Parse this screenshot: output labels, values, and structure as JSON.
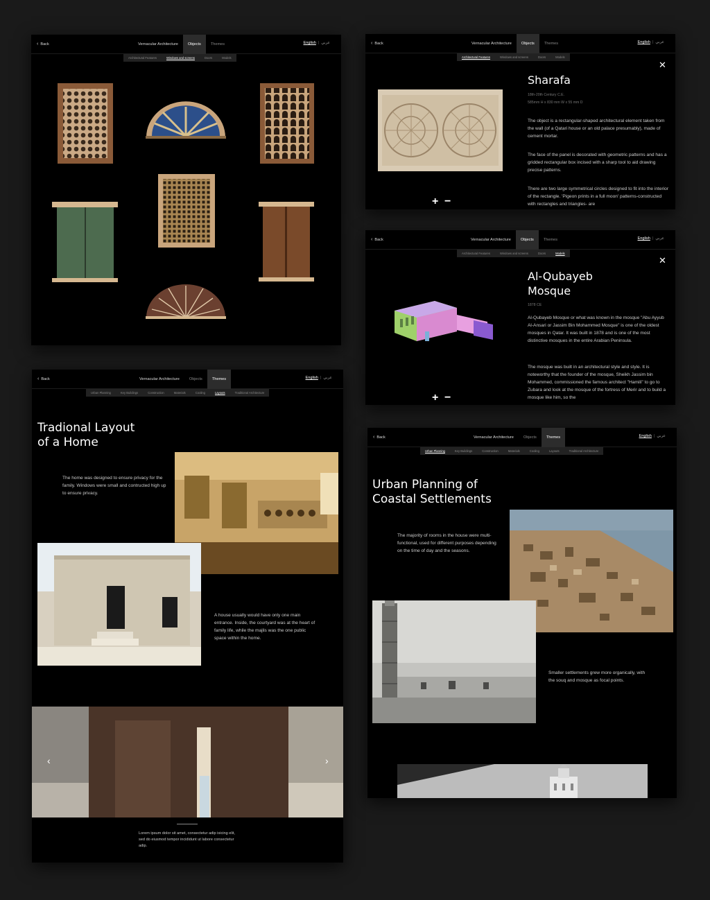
{
  "nav": {
    "back": "Back",
    "title": "Vernacular Architecture",
    "objects": "Objects",
    "themes": "Themes",
    "lang_en": "English",
    "lang_ar": "عربي"
  },
  "object_subnav": [
    "Architectural Features",
    "Windows and screens",
    "Doors",
    "Models"
  ],
  "theme_subnav": [
    "Urban Planning",
    "Key Buildings",
    "Construction",
    "Materials",
    "Cooling",
    "Layouts",
    "Traditional Architecture"
  ],
  "panel_gallery": {
    "active_tab": "Objects",
    "active_sub": "Windows and screens"
  },
  "panel_sharafa": {
    "active_tab": "Objects",
    "active_sub": "Architectural Features",
    "title": "Sharafa",
    "date": "18th-20th Century C.E.",
    "dimensions": "585mm H x 830 mm W x 55 mm D",
    "p1": "The object is a rectangular-shaped architectural element taken from the wall (of a Qatari house or an old palace presumably), made of cement mortar.",
    "p2": "The face of the panel is decorated with geometric patterns and has a gridded rectangular box incised with a sharp tool to aid drawing precise patterns.",
    "p3": "There are two large symmetrical circles designed to fit into the interior of the rectangle. 'Pigeon prints in a full moon' patterns-constructed with rectangles and triangles- are",
    "close": "✕",
    "zoom_in": "+",
    "zoom_out": "−"
  },
  "panel_mosque": {
    "active_tab": "Objects",
    "active_sub": "Models",
    "title_line1": "Al-Qubayeb",
    "title_line2": "Mosque",
    "date": "1878 CE",
    "p1": "Al-Qubayeb Mosque or what was known in the mosque \"Abu Ayyub Al-Ansari or Jassim Bin Mohammed Mosque\" is one of the oldest mosques in Qatar. It was built in 1878 and is one of the most distinctive mosques in the entire Arabian Peninsula.",
    "p2": "The mosque was built in an architectural style and style. It is noteworthy that the founder of the mosque, Sheikh Jassim bin Mohammed, commissioned the famous architect \"Hamili\" to go to Zubara and look at the mosque of the fortress of Merir and to build a mosque like him, so the",
    "close": "✕",
    "zoom_in": "+",
    "zoom_out": "−"
  },
  "panel_layout": {
    "active_tab": "Themes",
    "active_sub": "Layouts",
    "title_line1": "Tradional Layout",
    "title_line2": "of a Home",
    "p1": "The home was designed to ensure privacy for the family. Windows were small and contructed high up to ensure privacy.",
    "p2": "A house usually would have only one main entrance. Inside, the courtyard was at the heart of family life, while the majlis was the one public space within the home.",
    "caption": "Lorem ipsum dolor sit amet, consectetur adip isicing elit, sed do eiusmod tempor incididunt ut labore consectetur adip.",
    "prev": "‹",
    "next": "›"
  },
  "panel_urban": {
    "active_tab": "Themes",
    "active_sub": "Urban Planning",
    "title_line1": "Urban Planning of",
    "title_line2": "Coastal Settlements",
    "p1": "The majority of rooms in the house were multi-functional, used for different purposes depending on the time of day and the seasons.",
    "p2": "Smaller settlements grew more organically, with the souq and mosque as focal points."
  },
  "colors": {
    "background": "#1a1a1a",
    "panel": "#000000",
    "tab_active": "#2c2c2c",
    "subnav": "#222222"
  }
}
